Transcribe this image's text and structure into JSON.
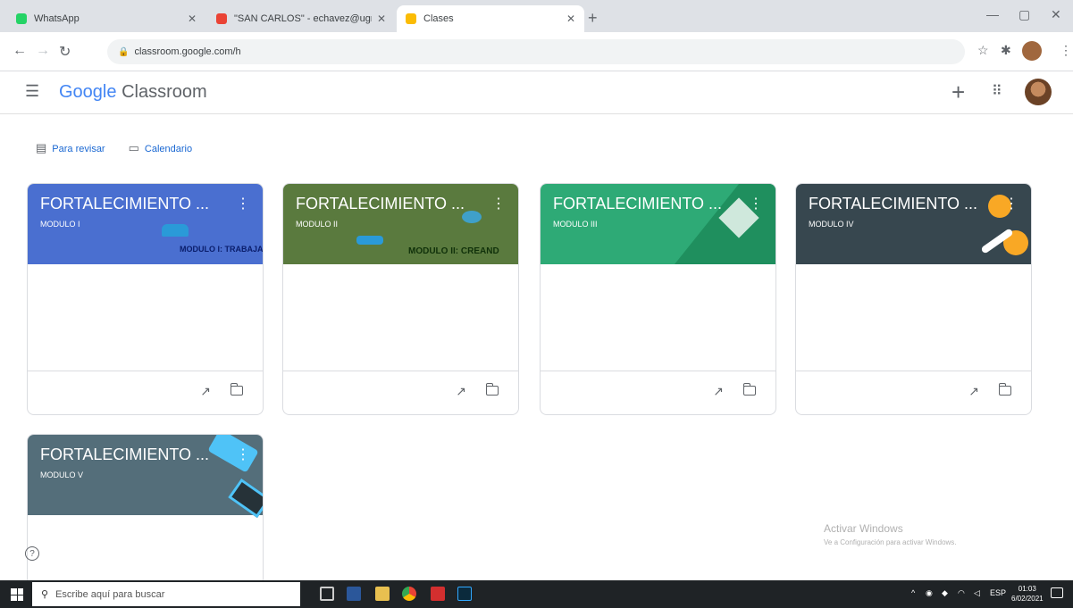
{
  "browser": {
    "tabs": [
      {
        "title": "WhatsApp",
        "fav_color": "#25d366"
      },
      {
        "title": "\"SAN CARLOS\" - echavez@ugr...",
        "fav_color": "#ea4335"
      },
      {
        "title": "Clases",
        "fav_color": "#fbbc05"
      }
    ],
    "url": "classroom.google.com/h"
  },
  "header": {
    "logo_google": "Google",
    "logo_product": "Classroom"
  },
  "links": {
    "to_review": "Para revisar",
    "calendar": "Calendario"
  },
  "courses": [
    {
      "title": "FORTALECIMIENTO ...",
      "section": "MODULO I",
      "banner_color": "#4a6fd0",
      "banner_text": "MODULO I: TRABAJAR"
    },
    {
      "title": "FORTALECIMIENTO ...",
      "section": "MODULO II",
      "banner_color": "#5a7a3e",
      "banner_text": "MODULO II: CREAND"
    },
    {
      "title": "FORTALECIMIENTO ...",
      "section": "MODULO III",
      "banner_color": "#2eaa76"
    },
    {
      "title": "FORTALECIMIENTO ...",
      "section": "MODULO IV",
      "banner_color": "#37474f"
    },
    {
      "title": "FORTALECIMIENTO ...",
      "section": "MODULO V",
      "banner_color": "#546e7a"
    }
  ],
  "watermark": {
    "title": "Activar Windows",
    "subtitle": "Ve a Configuración para activar Windows."
  },
  "taskbar": {
    "search_placeholder": "Escribe aquí para buscar",
    "lang": "ESP",
    "time": "01:03",
    "date": "6/02/2021"
  }
}
